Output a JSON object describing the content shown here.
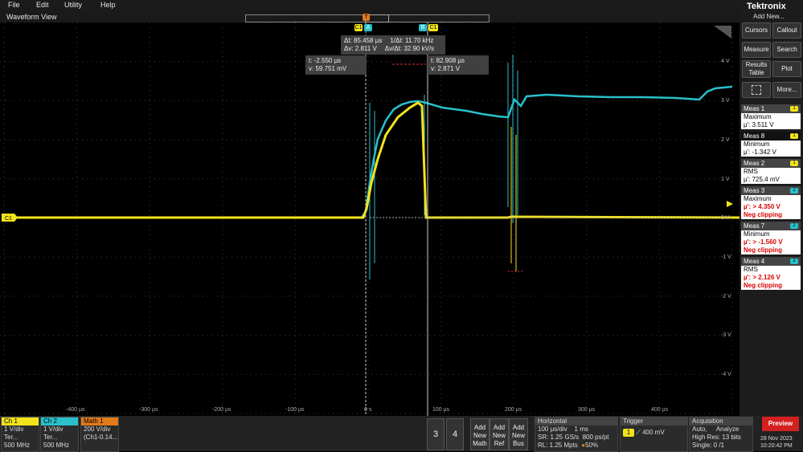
{
  "menu": [
    "File",
    "Edit",
    "Utility",
    "Help"
  ],
  "waveform_title": "Waveform View",
  "brand": "Tektronix",
  "add_new": "Add New...",
  "side_buttons": {
    "cursors": "Cursors",
    "callout": "Callout",
    "measure": "Measure",
    "search": "Search",
    "results_l1": "Results",
    "results_l2": "Table",
    "plot": "Plot",
    "more": "More..."
  },
  "y_labels": [
    "4 V",
    "3 V",
    "2 V",
    "1 V",
    "0 V",
    "-1 V",
    "-2 V",
    "-3 V",
    "-4 V"
  ],
  "x_labels": [
    "-400 µs",
    "-300 µs",
    "-200 µs",
    "-100 µs",
    "0 s",
    "100 µs",
    "200 µs",
    "300 µs",
    "400 µs"
  ],
  "cursor_delta": {
    "dt": "Δt: 85.458 µs",
    "inv": "1/Δt: 11.70 kHz",
    "dv": "Δv: 2.811 V",
    "dvdt": "Δv/Δt: 32.90 kV/s"
  },
  "cursor_a": {
    "t": "t: -2.550 µs",
    "v": "v: 59.751 mV"
  },
  "cursor_b": {
    "t": "t: 82.908 µs",
    "v": "v: 2.871 V"
  },
  "markers": {
    "c1": "C1",
    "a": "A",
    "b": "B",
    "t": "T"
  },
  "meas": [
    {
      "name": "Meas 1",
      "tag": "1",
      "type": "Maximum",
      "value": "µ': 3.511 V",
      "warn": ""
    },
    {
      "name": "Meas 8",
      "tag": "1",
      "type": "Minimum",
      "value": "µ': -1.342 V",
      "warn": ""
    },
    {
      "name": "Meas 2",
      "tag": "1",
      "type": "RMS",
      "value": "µ': 725.4 mV",
      "warn": ""
    },
    {
      "name": "Meas 3",
      "tag": "2",
      "type": "Maximum",
      "value": "µ': > 4.350 V",
      "warn": "Neg clipping"
    },
    {
      "name": "Meas 7",
      "tag": "2",
      "type": "Minimum",
      "value": "µ': > -1.560 V",
      "warn": "Neg clipping"
    },
    {
      "name": "Meas 4",
      "tag": "2",
      "type": "RMS",
      "value": "µ': > 2.126 V",
      "warn": "Neg clipping"
    }
  ],
  "channels": [
    {
      "name": "Ch 1",
      "l1": "1 V/div",
      "l2": "Ter...",
      "l3": "500 MHz",
      "color": "#f2e41a"
    },
    {
      "name": "Ch 2",
      "l1": "1 V/div",
      "l2": "Ter...",
      "l3": "500 MHz",
      "color": "#29c0cc"
    },
    {
      "name": "Math 1",
      "l1": "200 V/div",
      "l2": "(Ch1-0.14...",
      "l3": "",
      "color": "#e07a1a"
    }
  ],
  "num_buttons": [
    "3",
    "4"
  ],
  "add_buttons": [
    [
      "Add",
      "New",
      "Math"
    ],
    [
      "Add",
      "New",
      "Ref"
    ],
    [
      "Add",
      "New",
      "Bus"
    ]
  ],
  "horizontal": {
    "title": "Horizontal",
    "l1a": "100 µs/div",
    "l1b": "1 ms",
    "l2a": "SR: 1.25 GS/s",
    "l2b": "800 ps/pt",
    "l3a": "RL: 1.25 Mpts",
    "l3b": "50%"
  },
  "trigger": {
    "title": "Trigger",
    "src": "1",
    "level": "400 mV"
  },
  "acquisition": {
    "title": "Acquisition",
    "l1a": "Auto,",
    "l1b": "Analyze",
    "l2": "High Res: 13 bits",
    "l3": "Single: 0 /1"
  },
  "preview": "Preview",
  "date": "28 Nov 2023",
  "time": "10:20:42 PM",
  "ch1_marker": "C1",
  "colors": {
    "ch1": "#f2e41a",
    "ch2": "#29c0cc",
    "math": "#e07a1a",
    "preview": "#d32020"
  }
}
